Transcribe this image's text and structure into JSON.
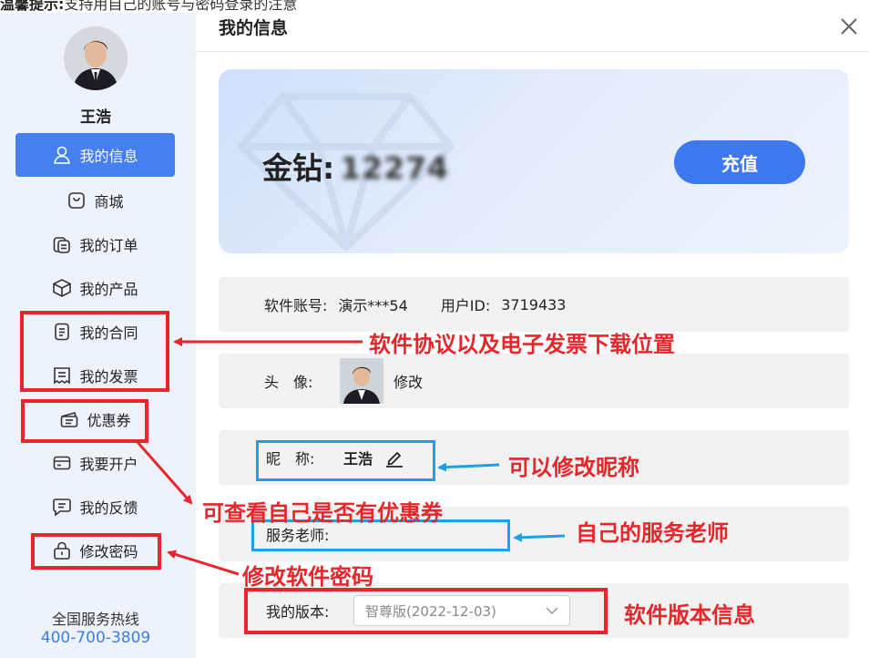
{
  "top_banner": {
    "bold": "温馨提示:",
    "rest": "支持用自己的账号与密码登录的注意"
  },
  "sidebar": {
    "user_name": "王浩",
    "items": [
      {
        "label": "我的信息",
        "icon": "user-icon",
        "active": true
      },
      {
        "label": "商城",
        "icon": "bag-icon"
      },
      {
        "label": "我的订单",
        "icon": "orders-icon"
      },
      {
        "label": "我的产品",
        "icon": "cube-icon"
      },
      {
        "label": "我的合同",
        "icon": "document-icon"
      },
      {
        "label": "我的发票",
        "icon": "invoice-icon"
      },
      {
        "label": "优惠券",
        "icon": "coupon-icon"
      },
      {
        "label": "我要开户",
        "icon": "card-icon"
      },
      {
        "label": "我的反馈",
        "icon": "feedback-icon"
      },
      {
        "label": "修改密码",
        "icon": "lock-icon"
      }
    ],
    "hotline_label": "全国服务热线",
    "hotline_number": "400-700-3809"
  },
  "dialog": {
    "title": "我的信息",
    "gold_label": "金钻:",
    "gold_value": "12274",
    "recharge_label": "充值",
    "account_label": "软件账号:",
    "account_value": "演示***54",
    "userid_label": "用户ID:",
    "userid_value": "3719433",
    "avatar_label": "头　像:",
    "avatar_edit": "修改",
    "nickname_label": "昵　称:",
    "nickname_value": "王浩",
    "teacher_label": "服务老师:",
    "version_label": "我的版本:",
    "version_value": "智尊版(2022-12-03)"
  },
  "annotations": {
    "contract_invoice": "软件协议以及电子发票下载位置",
    "nickname": "可以修改昵称",
    "coupon": "可查看自己是否有优惠券",
    "teacher": "自己的服务老师",
    "password": "修改软件密码",
    "version": "软件版本信息"
  },
  "colors": {
    "accent": "#4680f0",
    "annotation_red": "#e6262b",
    "annotation_blue": "#1da1e6"
  }
}
